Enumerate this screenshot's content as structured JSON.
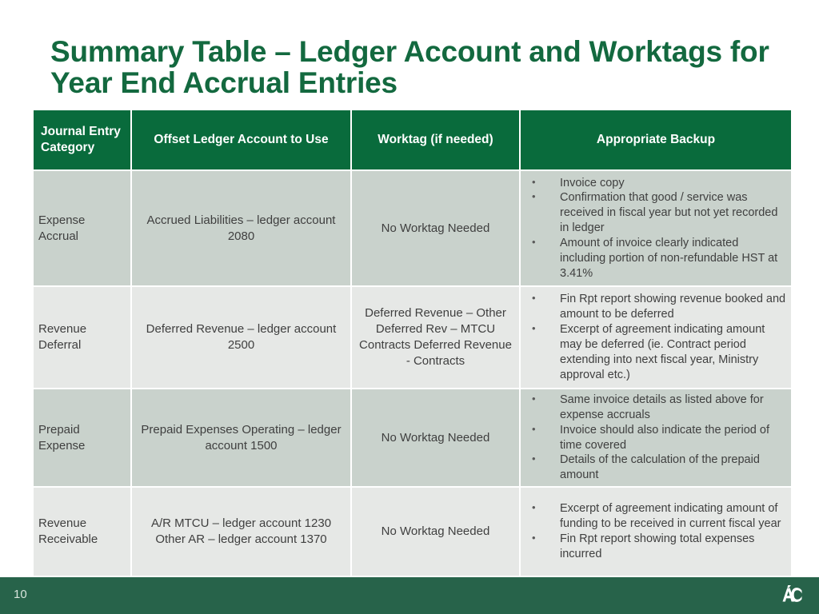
{
  "slide": {
    "title": "Summary Table – Ledger Account and Worktags for Year End Accrual Entries",
    "page_number": "10",
    "logo_name": "algonquin-college-ac-logo",
    "colors": {
      "header_green": "#096b3c",
      "title_green": "#13693f",
      "footer_green": "#27634a",
      "row_shade_dark": "#c9d2cc",
      "row_shade_light": "#e6e8e6",
      "body_text": "#3f3f3f"
    }
  },
  "table": {
    "columns": [
      "Journal Entry Category",
      "Offset Ledger Account to Use",
      "Worktag (if needed)",
      "Appropriate Backup"
    ],
    "rows": [
      {
        "category": "Expense Accrual",
        "offset_ledger_account": "Accrued Liabilities – ledger account 2080",
        "worktag": "No Worktag Needed",
        "backup": [
          "Invoice copy",
          "Confirmation that good / service was received in fiscal year but not yet recorded in ledger",
          "Amount of invoice clearly indicated including portion of non-refundable HST at 3.41%"
        ]
      },
      {
        "category": "Revenue Deferral",
        "offset_ledger_account": "Deferred Revenue – ledger account 2500",
        "worktag": "Deferred Revenue – Other Deferred Rev – MTCU Contracts Deferred Revenue - Contracts",
        "backup": [
          "Fin Rpt report showing revenue booked and amount to be deferred",
          "Excerpt of agreement indicating amount may be deferred (ie. Contract period extending into next fiscal year, Ministry approval etc.)"
        ]
      },
      {
        "category": "Prepaid Expense",
        "offset_ledger_account": "Prepaid Expenses Operating – ledger account 1500",
        "worktag": "No Worktag Needed",
        "backup": [
          "Same invoice details as listed above for expense accruals",
          "Invoice should also indicate the period of time covered",
          "Details of the calculation of the prepaid amount"
        ]
      },
      {
        "category": "Revenue Receivable",
        "offset_ledger_account": "A/R MTCU – ledger account 1230 Other AR – ledger account 1370",
        "worktag": "No Worktag Needed",
        "backup": [
          "Excerpt of agreement indicating amount of funding to be received in current fiscal year",
          "Fin Rpt report showing total expenses incurred"
        ]
      }
    ]
  }
}
